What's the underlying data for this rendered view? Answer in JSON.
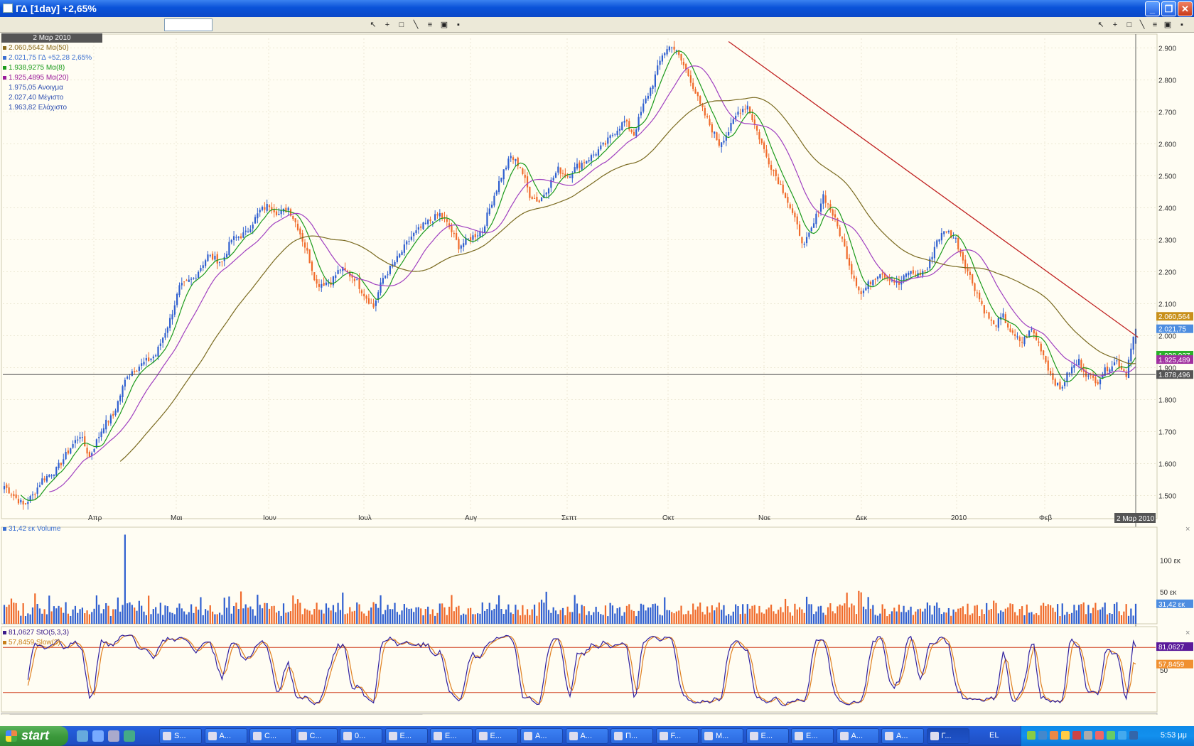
{
  "window": {
    "title": "ΓΔ [1day] +2,65%"
  },
  "price_pane": {
    "date_box": "2 Μαρ 2010",
    "legend": [
      {
        "text": "2.060,5642 Μα(50)",
        "color": "#8a6a1a"
      },
      {
        "text": "2.021,75 ΓΔ +52,28 2,65%",
        "color": "#3b6fd0"
      },
      {
        "text": "1.938,9275 Μα(8)",
        "color": "#1a9a1a"
      },
      {
        "text": "1.925,4895 Μα(20)",
        "color": "#9a1a9a"
      },
      {
        "text": "1.975,05 Ανοιγμα",
        "color": "#3050b0"
      },
      {
        "text": "2.027,40 Μέγιστο",
        "color": "#3050b0"
      },
      {
        "text": "1.963,82 Ελάχιστο",
        "color": "#3050b0"
      }
    ],
    "right_labels": [
      {
        "text": "2.060,564",
        "value": 2060.5642,
        "color": "#c8901a"
      },
      {
        "text": "2.021,75",
        "value": 2021.75,
        "color": "#4d8de0"
      },
      {
        "text": "1.938,927",
        "value": 1938.9275,
        "color": "#2ab02a"
      },
      {
        "text": "1.925,489",
        "value": 1925.4895,
        "color": "#a030a0"
      },
      {
        "text": "1.878,496",
        "value": 1878.496,
        "color": "#555555"
      }
    ],
    "cursor_date": "2 Μαρ 2010",
    "crosshair_value": 1878.496
  },
  "volume_pane": {
    "legend": "31,42 εκ Volume",
    "axis_ticks": [
      {
        "text": "100 εκ",
        "value": 100
      },
      {
        "text": "50 εκ",
        "value": 50
      }
    ],
    "right_label": "31,42 εκ",
    "last_value": 31.42
  },
  "stoch_pane": {
    "legend_k": "81,0627 StO(5,3,3)",
    "legend_d": "57,8459 Slow(3)",
    "axis_tick": "50",
    "right_k": "81,0627",
    "right_d": "57,8459",
    "k_last": 81.0627,
    "d_last": 57.8459
  },
  "chart_data": [
    {
      "type": "candlestick",
      "title": "",
      "ylim": [
        1450,
        2930
      ],
      "yticks": [
        "1.500",
        "1.600",
        "1.700",
        "1.800",
        "1.900",
        "2.000",
        "2.100",
        "2.200",
        "2.300",
        "2.400",
        "2.500",
        "2.600",
        "2.700",
        "2.800",
        "2.900"
      ],
      "ytick_values": [
        1500,
        1600,
        1700,
        1800,
        1900,
        2000,
        2100,
        2200,
        2300,
        2400,
        2500,
        2600,
        2700,
        2800,
        2900
      ],
      "xticks": [
        "Απρ",
        "Μαι",
        "Ιουν",
        "Ιουλ",
        "Αυγ",
        "Σεπτ",
        "Οκτ",
        "Νοε",
        "Δεκ",
        "2010",
        "Φεβ"
      ],
      "close_anchors": [
        [
          0,
          1530
        ],
        [
          8,
          1470
        ],
        [
          12,
          1500
        ],
        [
          16,
          1550
        ],
        [
          22,
          1580
        ],
        [
          28,
          1650
        ],
        [
          32,
          1690
        ],
        [
          36,
          1620
        ],
        [
          42,
          1720
        ],
        [
          46,
          1750
        ],
        [
          52,
          1880
        ],
        [
          56,
          1900
        ],
        [
          60,
          1920
        ],
        [
          64,
          1940
        ],
        [
          70,
          2050
        ],
        [
          74,
          2150
        ],
        [
          80,
          2180
        ],
        [
          86,
          2250
        ],
        [
          92,
          2230
        ],
        [
          96,
          2300
        ],
        [
          102,
          2320
        ],
        [
          108,
          2390
        ],
        [
          112,
          2410
        ],
        [
          116,
          2380
        ],
        [
          120,
          2400
        ],
        [
          124,
          2340
        ],
        [
          128,
          2260
        ],
        [
          132,
          2160
        ],
        [
          138,
          2170
        ],
        [
          142,
          2210
        ],
        [
          148,
          2180
        ],
        [
          152,
          2130
        ],
        [
          156,
          2090
        ],
        [
          160,
          2180
        ],
        [
          166,
          2240
        ],
        [
          172,
          2310
        ],
        [
          178,
          2350
        ],
        [
          184,
          2380
        ],
        [
          188,
          2340
        ],
        [
          192,
          2280
        ],
        [
          196,
          2300
        ],
        [
          202,
          2330
        ],
        [
          206,
          2420
        ],
        [
          210,
          2500
        ],
        [
          214,
          2560
        ],
        [
          218,
          2530
        ],
        [
          222,
          2440
        ],
        [
          226,
          2420
        ],
        [
          230,
          2470
        ],
        [
          234,
          2520
        ],
        [
          238,
          2500
        ],
        [
          242,
          2530
        ],
        [
          248,
          2560
        ],
        [
          254,
          2600
        ],
        [
          258,
          2640
        ],
        [
          262,
          2670
        ],
        [
          266,
          2630
        ],
        [
          270,
          2720
        ],
        [
          274,
          2790
        ],
        [
          278,
          2880
        ],
        [
          282,
          2910
        ],
        [
          286,
          2860
        ],
        [
          290,
          2800
        ],
        [
          294,
          2720
        ],
        [
          298,
          2660
        ],
        [
          302,
          2600
        ],
        [
          306,
          2640
        ],
        [
          310,
          2700
        ],
        [
          314,
          2720
        ],
        [
          318,
          2640
        ],
        [
          322,
          2560
        ],
        [
          326,
          2500
        ],
        [
          330,
          2440
        ],
        [
          334,
          2360
        ],
        [
          338,
          2280
        ],
        [
          342,
          2350
        ],
        [
          346,
          2440
        ],
        [
          350,
          2380
        ],
        [
          354,
          2300
        ],
        [
          358,
          2200
        ],
        [
          362,
          2130
        ],
        [
          366,
          2170
        ],
        [
          370,
          2200
        ],
        [
          374,
          2180
        ],
        [
          378,
          2160
        ],
        [
          382,
          2200
        ],
        [
          386,
          2190
        ],
        [
          390,
          2210
        ],
        [
          394,
          2300
        ],
        [
          398,
          2330
        ],
        [
          402,
          2300
        ],
        [
          406,
          2220
        ],
        [
          410,
          2150
        ],
        [
          414,
          2080
        ],
        [
          418,
          2030
        ],
        [
          422,
          2060
        ],
        [
          426,
          2000
        ],
        [
          430,
          1980
        ],
        [
          434,
          2020
        ],
        [
          438,
          1960
        ],
        [
          442,
          1880
        ],
        [
          446,
          1830
        ],
        [
          450,
          1890
        ],
        [
          454,
          1920
        ],
        [
          458,
          1870
        ],
        [
          462,
          1860
        ],
        [
          466,
          1900
        ],
        [
          470,
          1920
        ],
        [
          474,
          1880
        ],
        [
          476,
          1970
        ],
        [
          478,
          2021.75
        ]
      ],
      "trendline": {
        "from": [
          306,
          2920
        ],
        "to": [
          479,
          1995
        ]
      },
      "ma_labels": [
        "Μα(8)",
        "Μα(20)",
        "Μα(50)"
      ]
    },
    {
      "type": "bar",
      "title": "",
      "ylim": [
        0,
        145
      ],
      "n": 479,
      "spike_index": 51,
      "spike_value": 140
    },
    {
      "type": "line",
      "title": "",
      "ylim": [
        0,
        100
      ],
      "levels": [
        80,
        20
      ],
      "series_labels": [
        "StO(5,3,3)",
        "Slow(3)"
      ]
    }
  ]
}
